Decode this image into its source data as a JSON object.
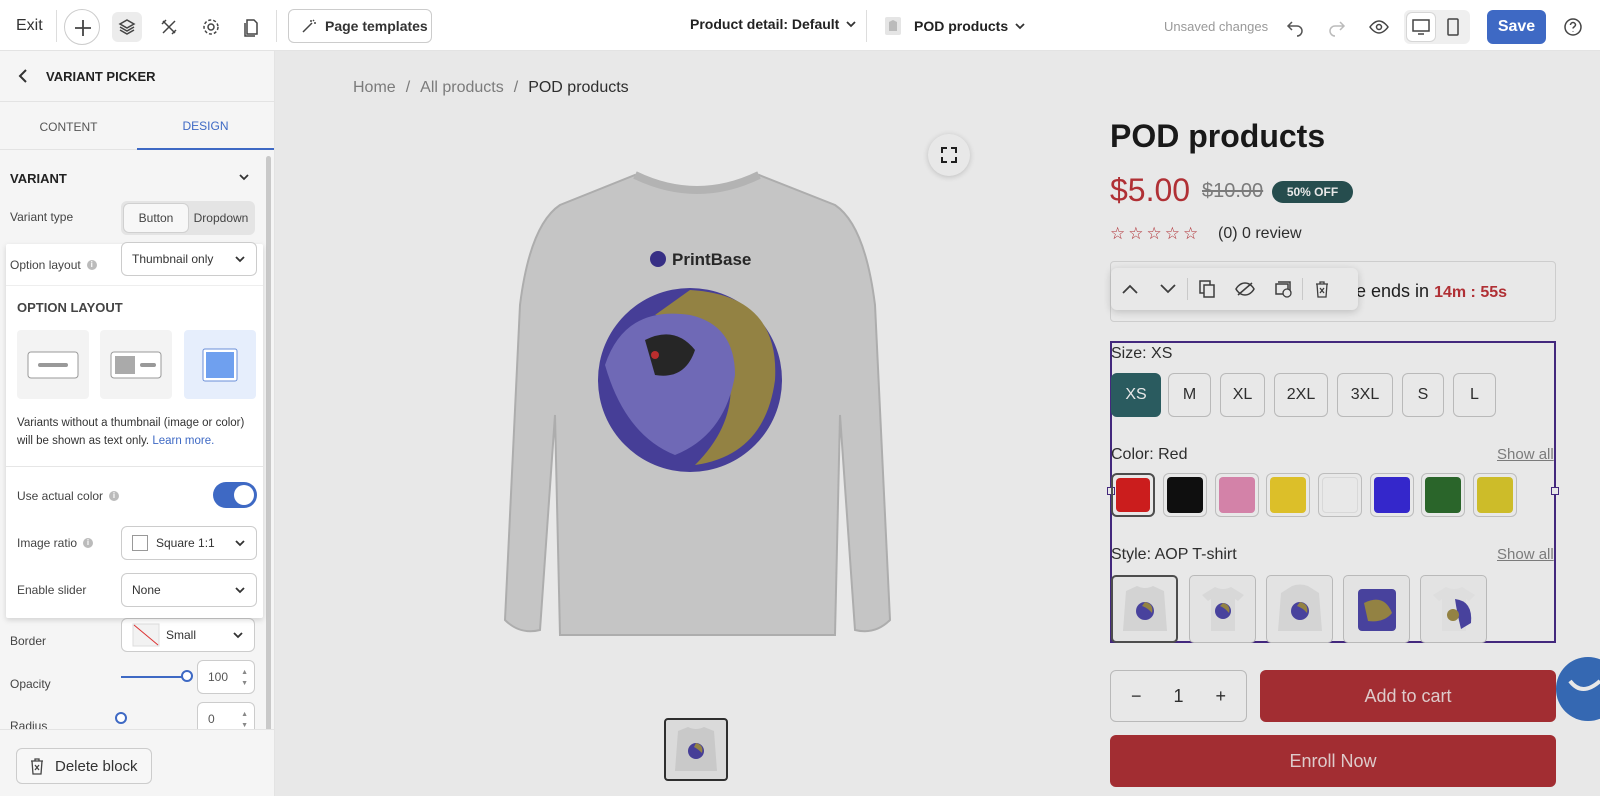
{
  "topbar": {
    "exit_label": "Exit",
    "page_templates_label": "Page templates",
    "page_selector": "Product detail: Default",
    "collection_selector": "POD products",
    "unsaved_label": "Unsaved changes",
    "save_label": "Save"
  },
  "sidebar": {
    "title": "VARIANT PICKER",
    "tabs": [
      "CONTENT",
      "DESIGN"
    ],
    "active_tab": "DESIGN",
    "section_title": "VARIANT",
    "variant_type_label": "Variant type",
    "variant_type_options": [
      "Button",
      "Dropdown"
    ],
    "variant_type_selected": "Button",
    "option_layout_label": "Option layout",
    "option_layout_value": "Thumbnail only",
    "border_label": "Border",
    "border_value": "Small",
    "opacity_label": "Opacity",
    "opacity_value": "100",
    "radius_label": "Radius",
    "radius_value": "0",
    "delete_label": "Delete block"
  },
  "popup": {
    "title": "OPTION LAYOUT",
    "description": "Variants without a thumbnail (image or color) will be shown as text only.",
    "learn_more": "Learn more.",
    "use_actual_color_label": "Use actual color",
    "use_actual_color_on": true,
    "image_ratio_label": "Image ratio",
    "image_ratio_value": "Square 1:1",
    "enable_slider_label": "Enable slider",
    "enable_slider_value": "None"
  },
  "breadcrumb": [
    "Home",
    "All products",
    "POD products"
  ],
  "product": {
    "title": "POD products",
    "price": "$5.00",
    "compare_price": "$10.00",
    "discount_badge": "50% OFF",
    "rating": 0,
    "review_text": "(0) 0 review",
    "sale_text_prefix": "e ends in",
    "sale_countdown": "14m : 55s",
    "brand_print": "PrintBase"
  },
  "variants": {
    "size_label": "Size: XS",
    "sizes": [
      "XS",
      "M",
      "XL",
      "2XL",
      "3XL",
      "S",
      "L"
    ],
    "size_selected": "XS",
    "color_label": "Color: Red",
    "show_all": "Show all",
    "colors": [
      "#e02020",
      "#111111",
      "#e88fb9",
      "#f2d22e",
      "#ffffff",
      "#3a2be0",
      "#2f6f2f",
      "#e2cf2e"
    ],
    "style_label": "Style: AOP T-shirt"
  },
  "cart": {
    "qty_minus": "−",
    "qty_value": "1",
    "qty_plus": "+",
    "add_to_cart": "Add to cart",
    "enroll": "Enroll Now"
  }
}
